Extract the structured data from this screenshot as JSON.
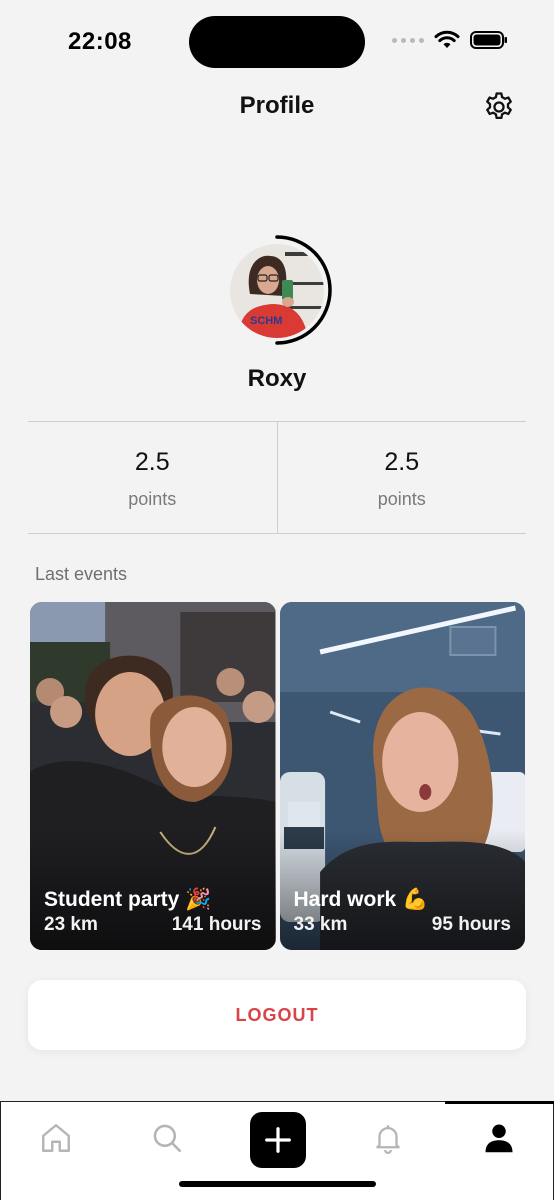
{
  "status_bar": {
    "time": "22:08"
  },
  "header": {
    "title": "Profile",
    "settings_icon": "gear-icon"
  },
  "profile": {
    "name": "Roxy"
  },
  "stats": [
    {
      "value": "2.5",
      "label": "points"
    },
    {
      "value": "2.5",
      "label": "points"
    }
  ],
  "events": {
    "section_title": "Last events",
    "items": [
      {
        "title": "Student party 🎉",
        "distance": "23 km",
        "duration": "141 hours"
      },
      {
        "title": "Hard work 💪",
        "distance": "33 km",
        "duration": "95 hours"
      }
    ]
  },
  "logout": {
    "label": "LOGOUT"
  },
  "colors": {
    "accent_red": "#d9434a",
    "background": "#f3f3f3",
    "tab_active": "#000000"
  },
  "tab_bar": {
    "items": [
      {
        "icon": "home-icon",
        "active": false
      },
      {
        "icon": "search-icon",
        "active": false
      },
      {
        "icon": "plus-icon",
        "active": false
      },
      {
        "icon": "bell-icon",
        "active": false
      },
      {
        "icon": "user-icon",
        "active": true
      }
    ]
  }
}
